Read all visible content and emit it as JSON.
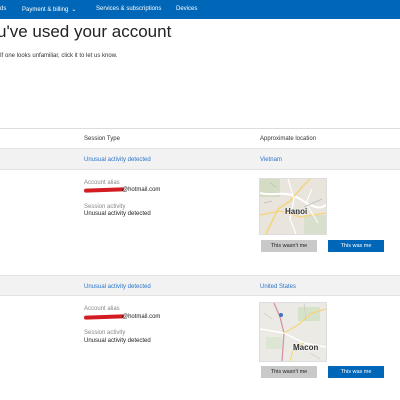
{
  "nav": {
    "items": [
      "ds",
      "Payment & billing",
      "Services & subscriptions",
      "Devices"
    ]
  },
  "page": {
    "title": "u've used your account",
    "subtitle": "If one looks unfamiliar, click it to let us know."
  },
  "table": {
    "headers": [
      "Session Type",
      "Approximate location"
    ]
  },
  "sessions": [
    {
      "session_type": "Unusual activity detected",
      "location": "Vietnam",
      "alias_label": "Account alias",
      "alias_value": "@hotmail.com",
      "activity_label": "Session activity",
      "activity_value": "Unusual activity detected",
      "map_label": "Hanoi",
      "btn_no": "This wasn't me",
      "btn_yes": "This was me"
    },
    {
      "session_type": "Unusual activity detected",
      "location": "United States",
      "alias_label": "Account alias",
      "alias_value": "@hotmail.com",
      "activity_label": "Session activity",
      "activity_value": "Unusual activity detected",
      "map_label": "Macon",
      "btn_no": "This wasn't me",
      "btn_yes": "This was me"
    }
  ],
  "colors": {
    "nav_bg": "#0067b8",
    "link": "#2a74c9",
    "primary_button": "#0067b8",
    "secondary_button": "#c9c9c9",
    "redaction": "#d21c22"
  }
}
